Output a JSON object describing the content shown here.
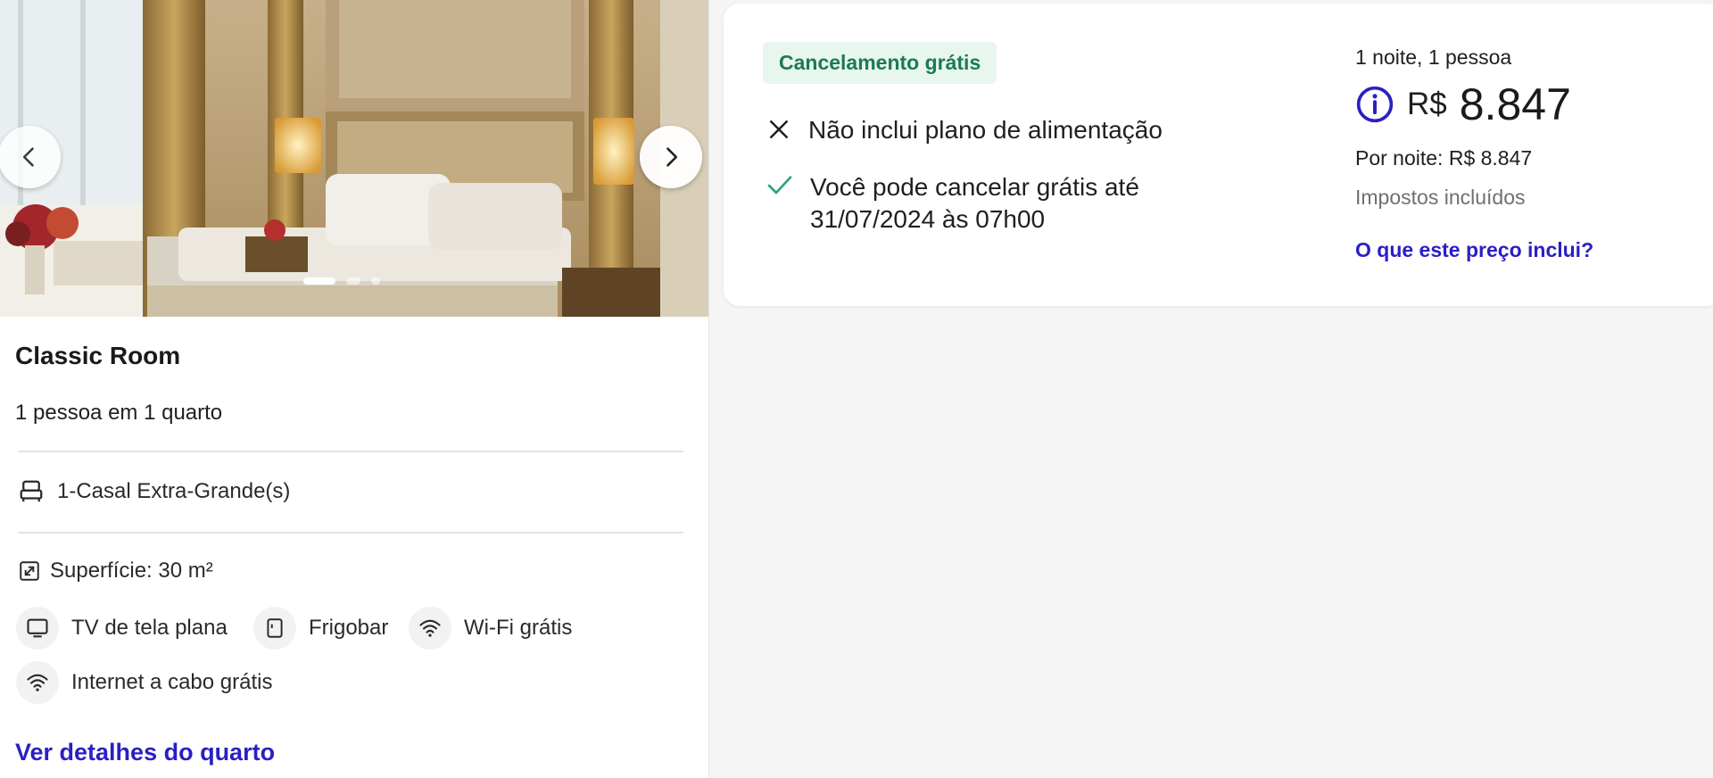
{
  "room": {
    "name": "Classic Room",
    "occupancy": "1 pessoa em 1 quarto",
    "bed": "1-Casal Extra-Grande(s)",
    "surface": "Superfície: 30 m²",
    "amenities": [
      {
        "icon": "tv-icon",
        "label": "TV de tela plana"
      },
      {
        "icon": "minibar-icon",
        "label": "Frigobar"
      },
      {
        "icon": "wifi-icon",
        "label": "Wi-Fi grátis"
      },
      {
        "icon": "wifi-icon",
        "label": "Internet a cabo grátis"
      }
    ],
    "details_link": "Ver detalhes do quarto"
  },
  "gallery": {
    "prev_icon": "chevron-left-icon",
    "next_icon": "chevron-right-icon",
    "photo_count": 3,
    "active_photo": 1
  },
  "rate": {
    "badge": "Cancelamento grátis",
    "meal": "Não inclui plano de alimentação",
    "cancel_line1": "Você pode cancelar grátis até",
    "cancel_line2": "31/07/2024 às 07h00",
    "stay": "1 noite, 1 pessoa",
    "currency": "R$",
    "amount": "8.847",
    "per_night": "Por noite: R$ 8.847",
    "taxes": "Impostos incluídos",
    "price_link": "O que este preço inclui?"
  },
  "colors": {
    "link": "#2a1fc4",
    "badge_bg": "#e7f6ef",
    "badge_text": "#1d7a52",
    "check": "#2aa57a"
  }
}
